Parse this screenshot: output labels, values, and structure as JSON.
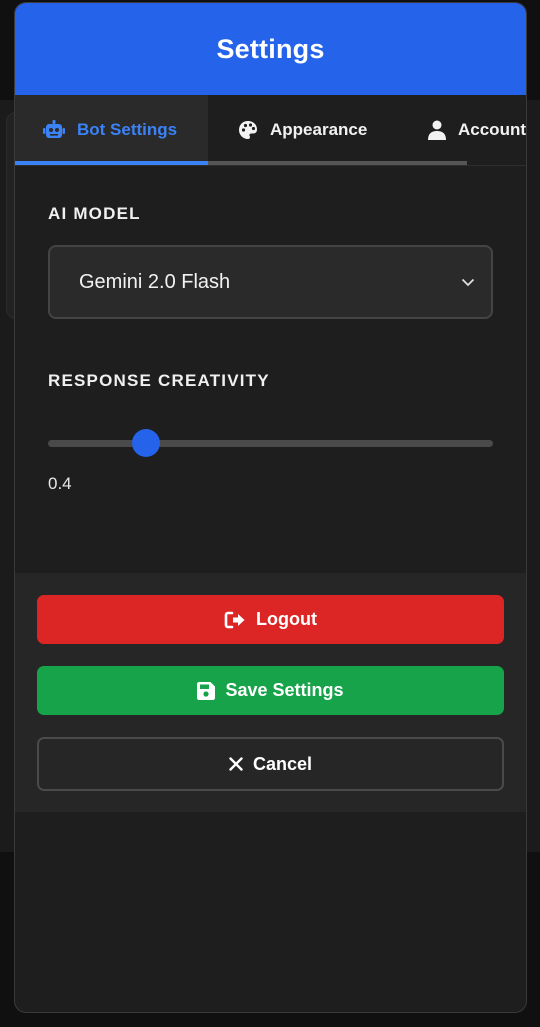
{
  "modal": {
    "title": "Settings"
  },
  "tabs": [
    {
      "label": "Bot Settings",
      "icon": "robot-icon",
      "active": true
    },
    {
      "label": "Appearance",
      "icon": "palette-icon",
      "active": false
    },
    {
      "label": "Account",
      "icon": "user-icon",
      "active": false
    }
  ],
  "bot_settings": {
    "model_label": "AI MODEL",
    "model_value": "Gemini 2.0 Flash",
    "creativity_label": "RESPONSE CREATIVITY",
    "creativity_value": "0.4",
    "creativity_fraction": 0.22
  },
  "actions": {
    "logout_label": "Logout",
    "save_label": "Save Settings",
    "cancel_label": "Cancel"
  },
  "colors": {
    "accent": "#2563eb",
    "danger": "#dc2626",
    "success": "#16a34a"
  }
}
